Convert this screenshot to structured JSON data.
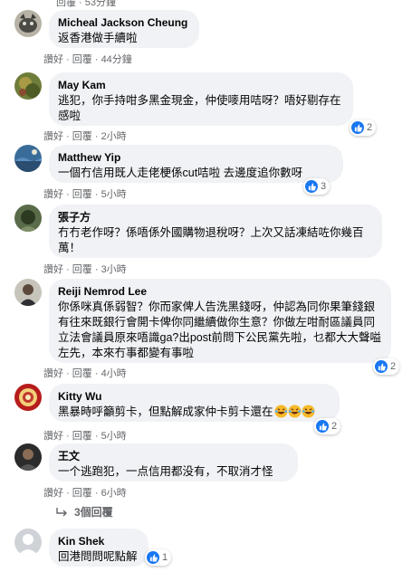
{
  "top_fragment": "回覆 · 53分鐘",
  "comments": [
    {
      "name": "Micheal Jackson Cheung",
      "text": "返香港做手續啦",
      "like": "讚好",
      "reply": "回覆",
      "time": "44分鐘"
    },
    {
      "name": "May Kam",
      "text": "逃犯，你手持咁多黑金現金，仲使嘜用咭呀？唔好剔存在感啦",
      "like": "讚好",
      "reply": "回覆",
      "time": "2小時",
      "reaction_count": "2"
    },
    {
      "name": "Matthew Yip",
      "text": "一個冇信用既人走佬梗係cut咭啦 去邊度追你數呀",
      "like": "讚好",
      "reply": "回覆",
      "time": "5小時",
      "reaction_count": "3"
    },
    {
      "name": "張子方",
      "text": "冇冇老作呀？係唔係外國購物退稅呀？上次又話凍結咗你幾百萬！",
      "like": "讚好",
      "reply": "回覆",
      "time": "3小時"
    },
    {
      "name": "Reiji Nemrod Lee",
      "text": "你係咪真係弱智？你而家俾人告洗黑錢呀，仲認為同你果筆錢銀有往來既銀行會開卡俾你同繼續做你生意？你做左咁耐區議員同立法會議員原來唔識ga?出post前問下公民黨先啦，乜都大大聲嗌左先，本來冇事都變有事啦",
      "like": "讚好",
      "reply": "回覆",
      "time": "4小時",
      "reaction_count": "2"
    },
    {
      "name": "Kitty Wu",
      "text": "黑暴時呼籲剪卡，但點解成家仲卡剪卡還在",
      "like": "讚好",
      "reply": "回覆",
      "time": "5小時",
      "reaction_count": "2"
    },
    {
      "name": "王文",
      "text": "一个逃跑犯，一点信用都没有，不取消才怪",
      "like": "讚好",
      "reply": "回覆",
      "time": "6小時"
    },
    {
      "name": "Kin Shek",
      "text": "回港問問呢點解",
      "reaction_count": "1"
    }
  ],
  "view_replies": "3個回覆",
  "colors": {
    "like_blue": "#1877f2",
    "bubble_bg": "#f0f2f5",
    "meta_gray": "#65676b"
  }
}
